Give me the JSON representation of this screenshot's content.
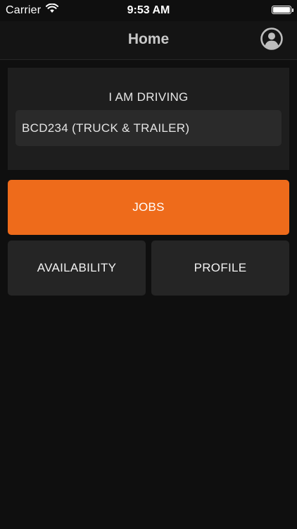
{
  "status_bar": {
    "carrier": "Carrier",
    "wifi_icon": "wifi-icon",
    "time": "9:53 AM",
    "battery_icon": "battery-icon",
    "battery_level": 1.0
  },
  "nav": {
    "title": "Home",
    "profile_icon": "user-circle-icon"
  },
  "driving": {
    "label": "I AM DRIVING",
    "vehicle": "BCD234 (TRUCK & TRAILER)"
  },
  "buttons": {
    "jobs": "JOBS",
    "availability": "AVAILABILITY",
    "profile": "PROFILE"
  },
  "colors": {
    "accent": "#ee6b1b",
    "background": "#0f0f0f",
    "card": "#1e1e1e",
    "tile": "#252525"
  }
}
